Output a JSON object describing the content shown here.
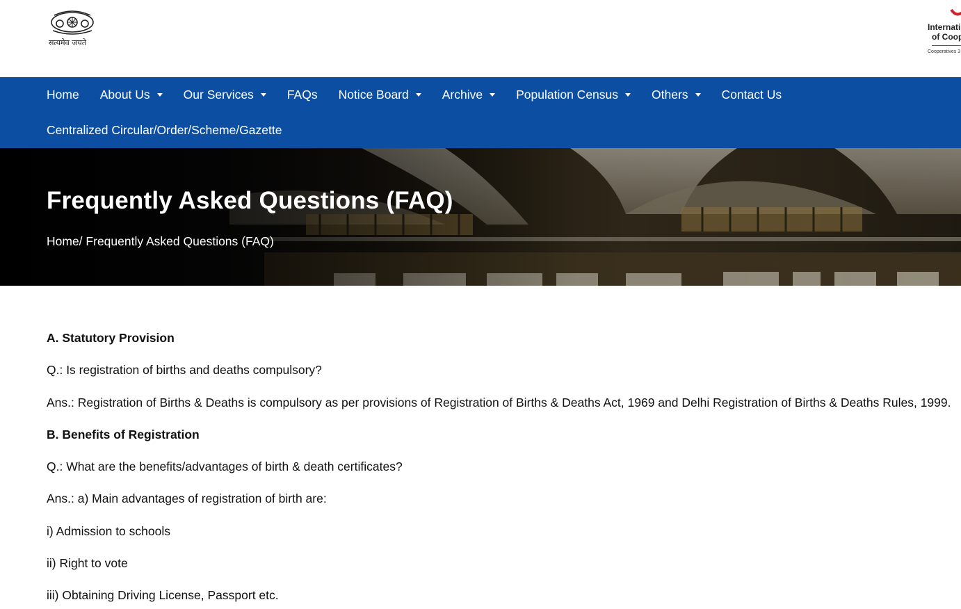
{
  "header": {
    "emblem_motto": "सत्यमेव जयते",
    "ica_logo": {
      "line1": "Internati",
      "line2": "of Coop",
      "line3": "Cooperatives 3"
    }
  },
  "nav": {
    "row1": [
      {
        "label": "Home",
        "dropdown": false
      },
      {
        "label": "About Us",
        "dropdown": true
      },
      {
        "label": "Our Services",
        "dropdown": true
      },
      {
        "label": "FAQs",
        "dropdown": false
      },
      {
        "label": "Notice Board",
        "dropdown": true
      },
      {
        "label": "Archive",
        "dropdown": true
      },
      {
        "label": "Population Census",
        "dropdown": true
      },
      {
        "label": "Others",
        "dropdown": true
      },
      {
        "label": "Contact Us",
        "dropdown": false
      }
    ],
    "row2": [
      {
        "label": "Centralized Circular/Order/Scheme/Gazette",
        "dropdown": false
      }
    ]
  },
  "banner": {
    "title": "Frequently Asked Questions (FAQ)",
    "breadcrumb_home": "Home/",
    "breadcrumb_current": "Frequently Asked Questions (FAQ)"
  },
  "content": {
    "paragraphs": [
      {
        "text": "A. Statutory Provision",
        "bold": true
      },
      {
        "text": "Q.: Is registration of births and deaths compulsory?",
        "bold": false
      },
      {
        "text": "Ans.: Registration of Births & Deaths is compulsory as per provisions of Registration of Births & Deaths Act, 1969 and Delhi Registration of Births & Deaths Rules, 1999.",
        "bold": false
      },
      {
        "text": "B. Benefits of Registration",
        "bold": true
      },
      {
        "text": "Q.: What are the benefits/advantages of birth & death certificates?",
        "bold": false
      },
      {
        "text": "Ans.: a) Main advantages of registration of birth are:",
        "bold": false
      },
      {
        "text": "i) Admission to schools",
        "bold": false
      },
      {
        "text": "ii) Right to vote",
        "bold": false
      },
      {
        "text": "iii) Obtaining Driving License, Passport etc.",
        "bold": false
      }
    ]
  },
  "colors": {
    "nav_bg": "#0b4ea2",
    "ica_red": "#d2232a"
  }
}
